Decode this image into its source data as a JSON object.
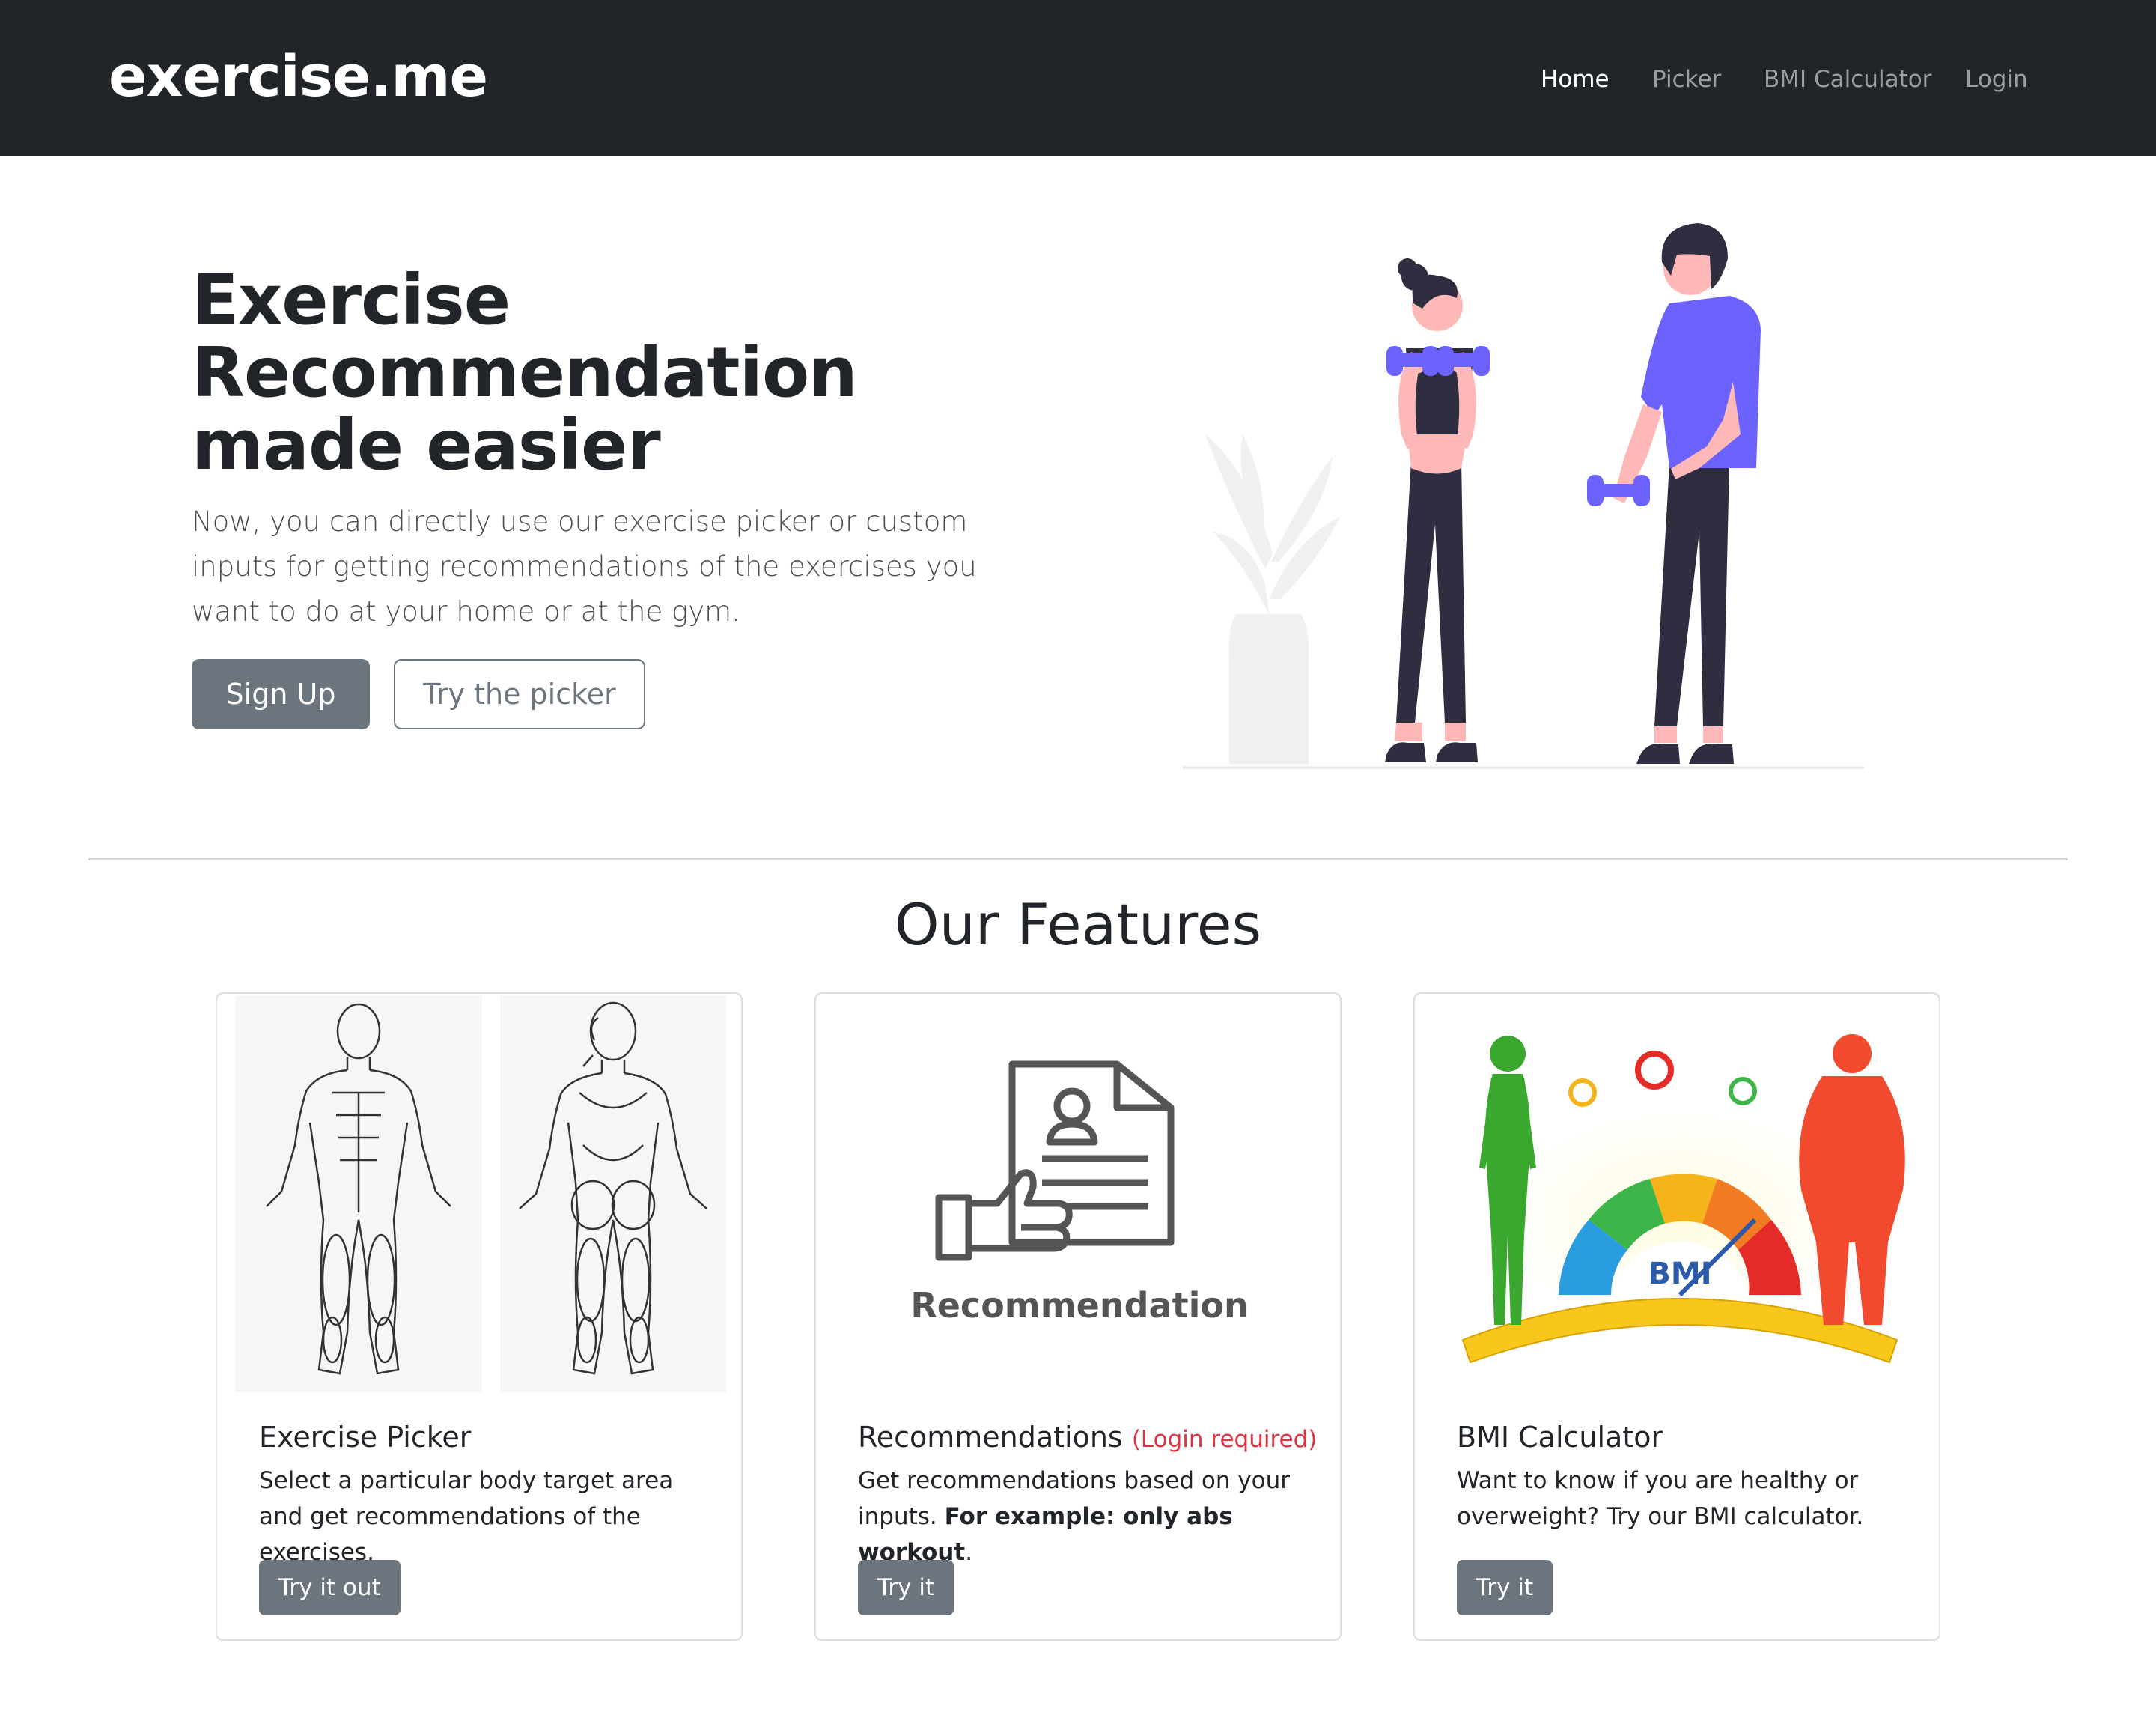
{
  "navbar": {
    "brand": "exercise.me",
    "links": [
      {
        "label": "Home",
        "active": true
      },
      {
        "label": "Picker",
        "active": false
      },
      {
        "label": "BMI Calculator",
        "active": false
      },
      {
        "label": "Login",
        "active": false
      }
    ]
  },
  "hero": {
    "title": "Exercise Recommendation made easier",
    "lead": "Now, you can directly use our exercise picker or custom inputs for getting recommendations of the exercises you want to do at your home or at the gym.",
    "primary_button": "Sign Up",
    "secondary_button": "Try the picker"
  },
  "features": {
    "title": "Our Features",
    "cards": [
      {
        "title": "Exercise Picker",
        "note": "",
        "text": "Select a particular body target area and get recommendations of the exercises.",
        "button": "Try it out"
      },
      {
        "title": "Recommendations",
        "note": "(Login required)",
        "text_plain": "Get recommendations based on your inputs. ",
        "text_bold": "For example: only abs workout",
        "text_end": ".",
        "image_caption": "Recommendation",
        "button": "Try it"
      },
      {
        "title": "BMI Calculator",
        "note": "",
        "text": "Want to know if you are healthy or overweight? Try our BMI calculator.",
        "image_label": "BMI",
        "button": "Try it"
      }
    ]
  },
  "colors": {
    "navbar_bg": "#212529",
    "button_secondary": "#6c757d",
    "danger": "#dc3545",
    "accent_purple": "#6c63ff"
  }
}
